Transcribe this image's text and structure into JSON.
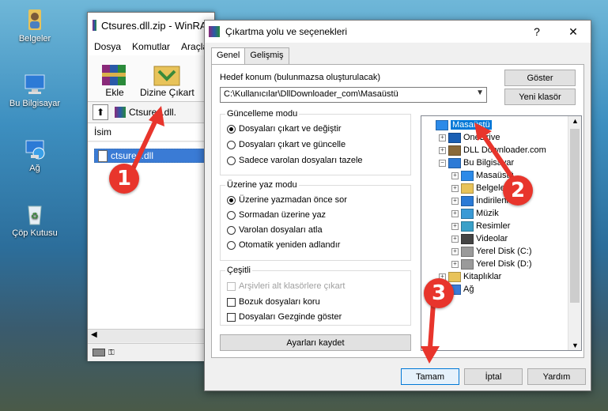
{
  "desktop": {
    "icons": [
      {
        "label": "Belgeler",
        "icon": "user-folder-icon"
      },
      {
        "label": "Bu Bilgisayar",
        "icon": "computer-icon"
      },
      {
        "label": "Ağ",
        "icon": "network-icon"
      },
      {
        "label": "Çöp Kutusu",
        "icon": "recycle-bin-icon"
      }
    ]
  },
  "bg_window": {
    "title": "Ctsures.dll.zip - WinRAR",
    "menu": [
      "Dosya",
      "Komutlar",
      "Araçlar"
    ],
    "toolbar": {
      "add_label": "Ekle",
      "extract_label": "Dizine Çıkart"
    },
    "address": "Ctsures.dll.",
    "column_name": "İsim",
    "file_name": "ctsures.dll"
  },
  "dialog": {
    "title": "Çıkartma yolu ve seçenekleri",
    "help_glyph": "?",
    "close_glyph": "✕",
    "tabs": [
      "Genel",
      "Gelişmiş"
    ],
    "dest_label": "Hedef konum (bulunmazsa oluşturulacak)",
    "dest_value": "C:\\Kullanıcılar\\DllDownloader_com\\Masaüstü",
    "show_button": "Göster",
    "new_folder_button": "Yeni klasör",
    "update_group": {
      "title": "Güncelleme modu",
      "options": [
        "Dosyaları çıkart ve değiştir",
        "Dosyaları çıkart ve güncelle",
        "Sadece varolan dosyaları tazele"
      ],
      "selected": 0
    },
    "overwrite_group": {
      "title": "Üzerine yaz modu",
      "options": [
        "Üzerine yazmadan önce sor",
        "Sormadan üzerine yaz",
        "Varolan dosyaları atla",
        "Otomatik yeniden adlandır"
      ],
      "selected": 0
    },
    "misc_group": {
      "title": "Çeşitli",
      "options": [
        {
          "label": "Arşivleri alt klasörlere çıkart",
          "checked": false,
          "disabled": true
        },
        {
          "label": "Bozuk dosyaları koru",
          "checked": false,
          "disabled": false
        },
        {
          "label": "Dosyaları Gezginde göster",
          "checked": false,
          "disabled": false
        }
      ]
    },
    "save_settings_button": "Ayarları kaydet",
    "tree": [
      {
        "label": "Masaüstü",
        "icon": "desktop-folder-icon",
        "level": 0,
        "expander": "",
        "selected": true
      },
      {
        "label": "OneDrive",
        "icon": "onedrive-cloud-icon",
        "level": 1,
        "expander": "+",
        "selected": false
      },
      {
        "label": "DLL Downloader.com",
        "icon": "user-icon",
        "level": 1,
        "expander": "+",
        "selected": false
      },
      {
        "label": "Bu Bilgisayar",
        "icon": "computer-icon",
        "level": 1,
        "expander": "−",
        "selected": false
      },
      {
        "label": "Masaüstü",
        "icon": "desktop-folder-icon",
        "level": 2,
        "expander": "+",
        "selected": false
      },
      {
        "label": "Belgeler",
        "icon": "documents-folder-icon",
        "level": 2,
        "expander": "+",
        "selected": false
      },
      {
        "label": "İndirilenler",
        "icon": "downloads-folder-icon",
        "level": 2,
        "expander": "+",
        "selected": false
      },
      {
        "label": "Müzik",
        "icon": "music-folder-icon",
        "level": 2,
        "expander": "+",
        "selected": false
      },
      {
        "label": "Resimler",
        "icon": "pictures-folder-icon",
        "level": 2,
        "expander": "+",
        "selected": false
      },
      {
        "label": "Videolar",
        "icon": "videos-folder-icon",
        "level": 2,
        "expander": "+",
        "selected": false
      },
      {
        "label": "Yerel Disk (C:)",
        "icon": "drive-icon",
        "level": 2,
        "expander": "+",
        "selected": false
      },
      {
        "label": "Yerel Disk (D:)",
        "icon": "drive-icon",
        "level": 2,
        "expander": "+",
        "selected": false
      },
      {
        "label": "Kitaplıklar",
        "icon": "library-folder-icon",
        "level": 1,
        "expander": "+",
        "selected": false
      },
      {
        "label": "Ağ",
        "icon": "network-icon",
        "level": 1,
        "expander": "+",
        "selected": false
      }
    ],
    "ok_button": "Tamam",
    "cancel_button": "İptal",
    "help_button": "Yardım"
  },
  "annotations": {
    "markers": [
      "1",
      "2",
      "3"
    ],
    "color": "#e8352c"
  }
}
